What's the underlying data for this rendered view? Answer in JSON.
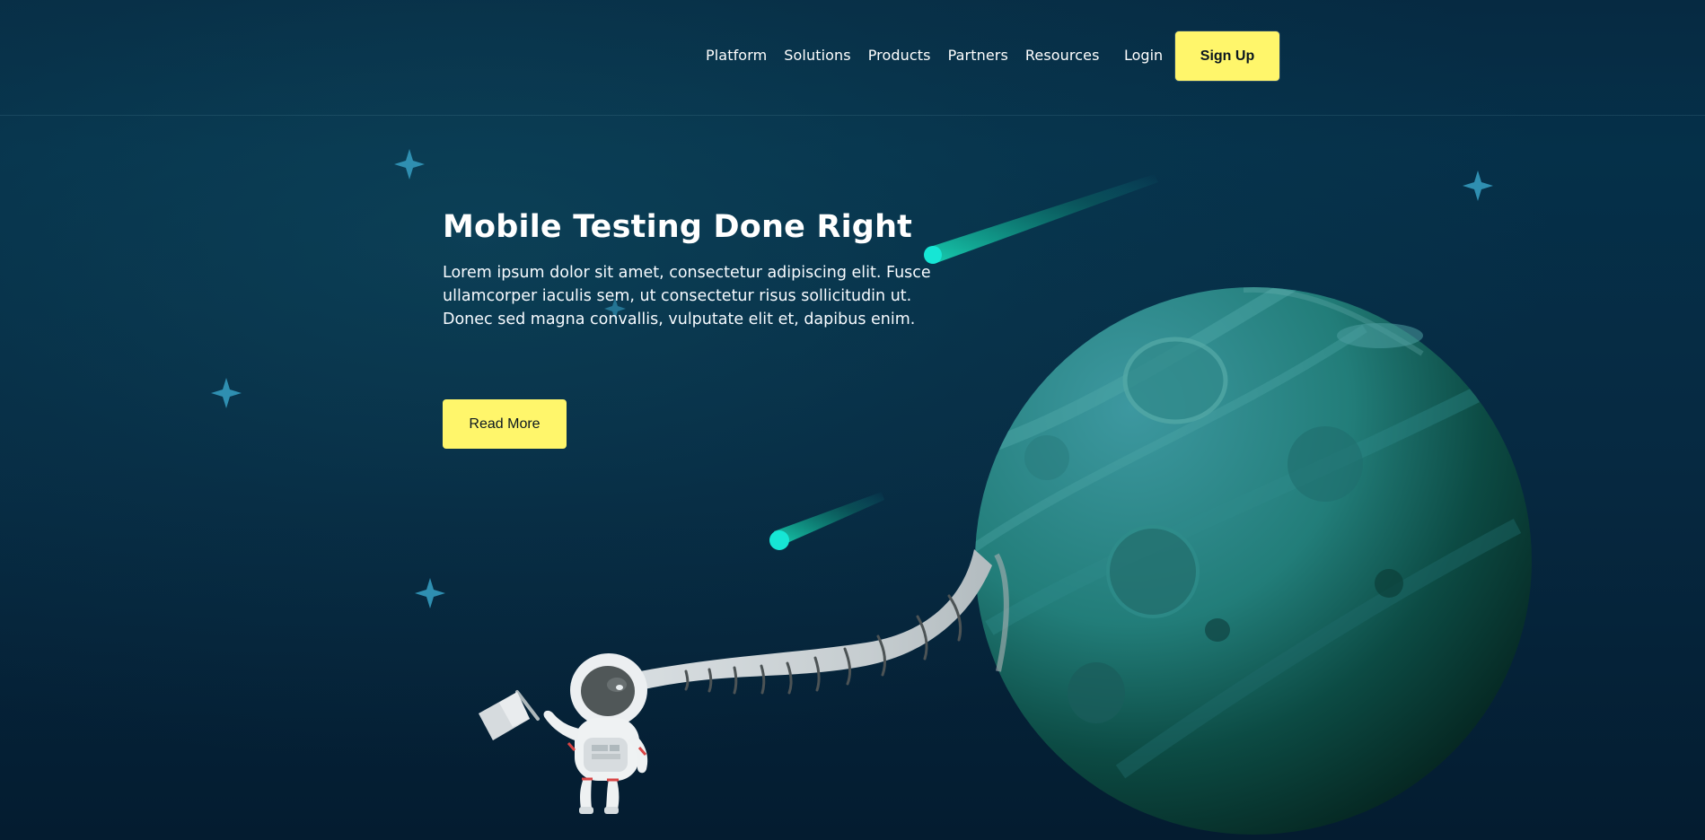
{
  "brand": {
    "background": "#062941",
    "accent": "#fff66b",
    "planet": "#2f8c8b",
    "meteor": "#14ead7",
    "star": "#3d93b7"
  },
  "header": {
    "nav_items": [
      {
        "label": "Platform"
      },
      {
        "label": "Solutions"
      },
      {
        "label": "Products"
      },
      {
        "label": "Partners"
      },
      {
        "label": "Resources"
      }
    ],
    "login_label": "Login",
    "signup_label": "Sign Up"
  },
  "hero": {
    "title": "Mobile Testing Done Right",
    "body": "Lorem ipsum dolor sit amet, consectetur adipiscing elit. Fusce ullamcorper iaculis sem, ut consectetur risus sollicitudin ut. Donec sed magna convallis, vulputate elit et, dapibus enim.",
    "button_label": "Read More"
  },
  "illustration": {
    "icons": [
      "sparkle-star-icon",
      "meteor-icon",
      "planet-icon",
      "astronaut-icon",
      "flag-icon",
      "tether-icon"
    ]
  }
}
